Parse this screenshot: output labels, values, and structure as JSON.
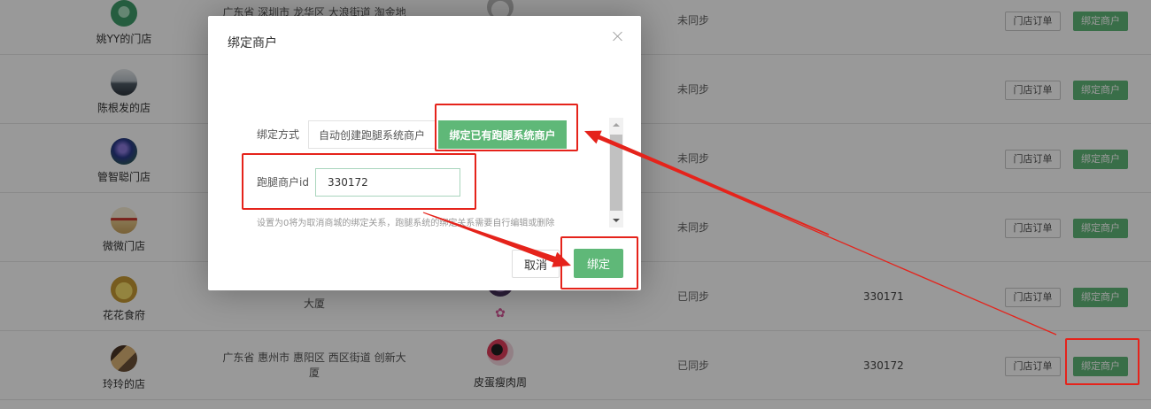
{
  "table": {
    "actions": {
      "orders_label": "门店订单",
      "bind_label": "绑定商户"
    },
    "rows": [
      {
        "store_name": "姚YY的门店",
        "address": [
          "广东省 深圳市 龙华区 大浪街道 淘金地"
        ],
        "sync_status": "未同步"
      },
      {
        "store_name": "陈根发的店",
        "sync_status": "未同步"
      },
      {
        "store_name": "管智聪门店",
        "sync_status": "未同步"
      },
      {
        "store_name": "微微门店",
        "sync_status": "未同步"
      },
      {
        "store_name": "花花食府",
        "address": [
          "大厦"
        ],
        "merchant_name": "✿",
        "sync_status": "已同步",
        "merchant_id": "330171"
      },
      {
        "store_name": "玲玲的店",
        "address": [
          "广东省 惠州市 惠阳区 西区街道 创新大",
          "厦"
        ],
        "merchant_name": "皮蛋瘦肉周",
        "sync_status": "已同步",
        "merchant_id": "330172"
      }
    ]
  },
  "modal": {
    "title": "绑定商户",
    "bind_method_label": "绑定方式",
    "tabs": [
      {
        "label": "自动创建跑腿系统商户",
        "active": false
      },
      {
        "label": "绑定已有跑腿系统商户",
        "active": true
      }
    ],
    "merchant_id_label": "跑腿商户id",
    "merchant_id_value": "330172",
    "hint": "设置为0将为取消商城的绑定关系，跑腿系统的绑定关系需要自行编辑或删除",
    "cancel_label": "取消",
    "confirm_label": "绑定"
  },
  "icons": {
    "modal_close": "close-icon",
    "scroll_up": "scroll-up-arrow-icon",
    "scroll_down": "scroll-down-arrow-icon"
  },
  "colors": {
    "primary_green": "#5FB878",
    "annotation_red": "#E5231B",
    "shade": "rgba(0,0,0,0.4)"
  }
}
